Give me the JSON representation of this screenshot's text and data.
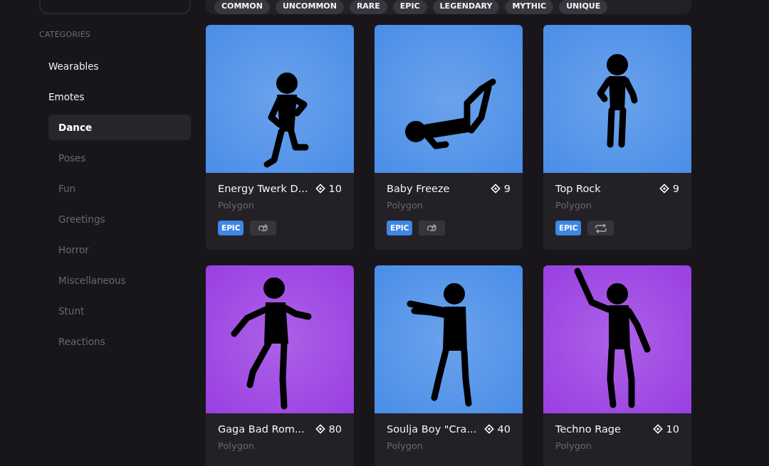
{
  "filters": [
    {
      "label": "COMMON"
    },
    {
      "label": "UNCOMMON"
    },
    {
      "label": "RARE"
    },
    {
      "label": "EPIC"
    },
    {
      "label": "LEGENDARY"
    },
    {
      "label": "MYTHIC"
    },
    {
      "label": "UNIQUE"
    }
  ],
  "sidebar": {
    "heading": "CATEGORIES",
    "items": [
      {
        "label": "Wearables",
        "selected": false
      },
      {
        "label": "Emotes",
        "selected": false,
        "children": [
          {
            "label": "Dance",
            "selected": true
          },
          {
            "label": "Poses",
            "selected": false
          },
          {
            "label": "Fun",
            "selected": false
          },
          {
            "label": "Greetings",
            "selected": false
          },
          {
            "label": "Horror",
            "selected": false
          },
          {
            "label": "Miscellaneous",
            "selected": false
          },
          {
            "label": "Stunt",
            "selected": false
          },
          {
            "label": "Reactions",
            "selected": false
          }
        ]
      }
    ]
  },
  "cards": [
    {
      "kind": "picture",
      "color": "#4a8ee8",
      "name": "Energy Twerk D...",
      "price": "10",
      "network": "Polygon",
      "rarity": "EPIC",
      "loop_once": true
    },
    {
      "kind": "picture",
      "color": "#4a8ee8",
      "name": "Baby Freeze",
      "price": "9",
      "network": "Polygon",
      "rarity": "EPIC",
      "loop_once": true
    },
    {
      "kind": "picture",
      "color": "#4a8ee8",
      "name": "Top Rock",
      "price": "9",
      "network": "Polygon",
      "rarity": "EPIC",
      "loop_once": false
    },
    {
      "kind": "picture",
      "color": "#9a3fe2",
      "name": "Gaga Bad Rom...",
      "price": "80",
      "network": "Polygon"
    },
    {
      "kind": "picture",
      "color": "#4a8ee8",
      "name": "Soulja Boy \"Cra...",
      "price": "40",
      "network": "Polygon"
    },
    {
      "kind": "picture",
      "color": "#9a3fe2",
      "name": "Techno Rage",
      "price": "10",
      "network": "Polygon"
    }
  ]
}
